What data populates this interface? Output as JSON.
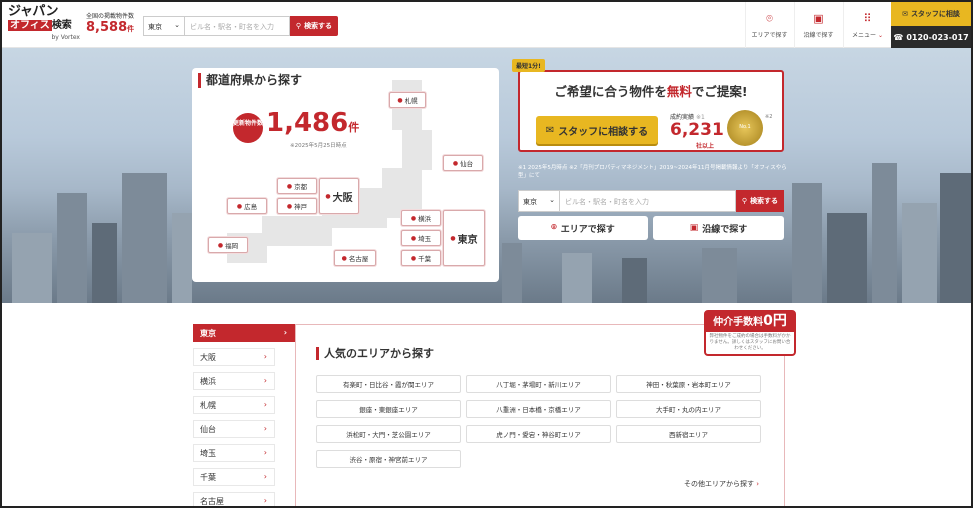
{
  "header": {
    "logo": {
      "line1": "ジャパン",
      "box": "オフィス",
      "rest": "検索",
      "by": "by Vortex"
    },
    "count": {
      "label": "全国の掲載物件数",
      "value": "8,588",
      "unit": "件"
    },
    "search": {
      "region": "東京",
      "placeholder": "ビル名・駅名・町名を入力",
      "button": "検索する"
    },
    "nav": [
      {
        "label": "エリアで探す",
        "icon": "pin-icon"
      },
      {
        "label": "沿線で探す",
        "icon": "train-icon"
      },
      {
        "label": "メニュー",
        "icon": "menu-icon"
      }
    ],
    "staff": "スタッフに相談",
    "tel": "0120-023-017"
  },
  "pref": {
    "title": "都道府県から探す",
    "badge": "更新物件数",
    "count": "1,486",
    "unit": "件",
    "asof": "※2025年5月25日時点",
    "pins": {
      "sapporo": "札幌",
      "sendai": "仙台",
      "kyoto": "京都",
      "osaka": "大阪",
      "hiroshima": "広島",
      "kobe": "神戸",
      "fukuoka": "福岡",
      "nagoya": "名古屋",
      "yokohama": "横浜",
      "saitama": "埼玉",
      "chiba": "千葉",
      "tokyo": "東京"
    }
  },
  "offer": {
    "tag": "最短1分!",
    "head_pre": "ご希望に合う物件を",
    "head_em": "無料",
    "head_post": "でご提案!",
    "button": "スタッフに相談する",
    "rec_label": "成約実績",
    "rec_note": "※1",
    "rec_num": "6,231",
    "rec_sub": "社以上",
    "medal": "No.1",
    "medal_note": "※2",
    "note": "※1 2025年5月時点 ※2「月刊プロパティマネジメント」2019~2024年11月号掲載情報より「オフィスやら型」にて"
  },
  "search2": {
    "region": "東京",
    "placeholder": "ビル名・駅名・町名を入力",
    "button": "検索する"
  },
  "actions": {
    "area": "エリアで探す",
    "line": "沿線で探す"
  },
  "sidebar": [
    "東京",
    "大阪",
    "横浜",
    "札幌",
    "仙台",
    "埼玉",
    "千葉",
    "名古屋"
  ],
  "areas": {
    "title": "人気のエリアから探す",
    "items": [
      "有楽町・日比谷・霞が関エリア",
      "八丁堀・茅場町・新川エリア",
      "神田・秋葉原・岩本町エリア",
      "銀座・東銀座エリア",
      "八重洲・日本橋・京橋エリア",
      "大手町・丸の内エリア",
      "浜松町・大門・芝公園エリア",
      "虎ノ門・愛宕・神谷町エリア",
      "西新宿エリア",
      "渋谷・原宿・神宮前エリア"
    ],
    "more": "その他エリアから探す"
  },
  "fee": {
    "label": "仲介手数料",
    "zero": "0円",
    "note": "弊社物件をご成約の場合は手数料がかかりません。詳しくはスタッフにお問い合わせください。"
  }
}
